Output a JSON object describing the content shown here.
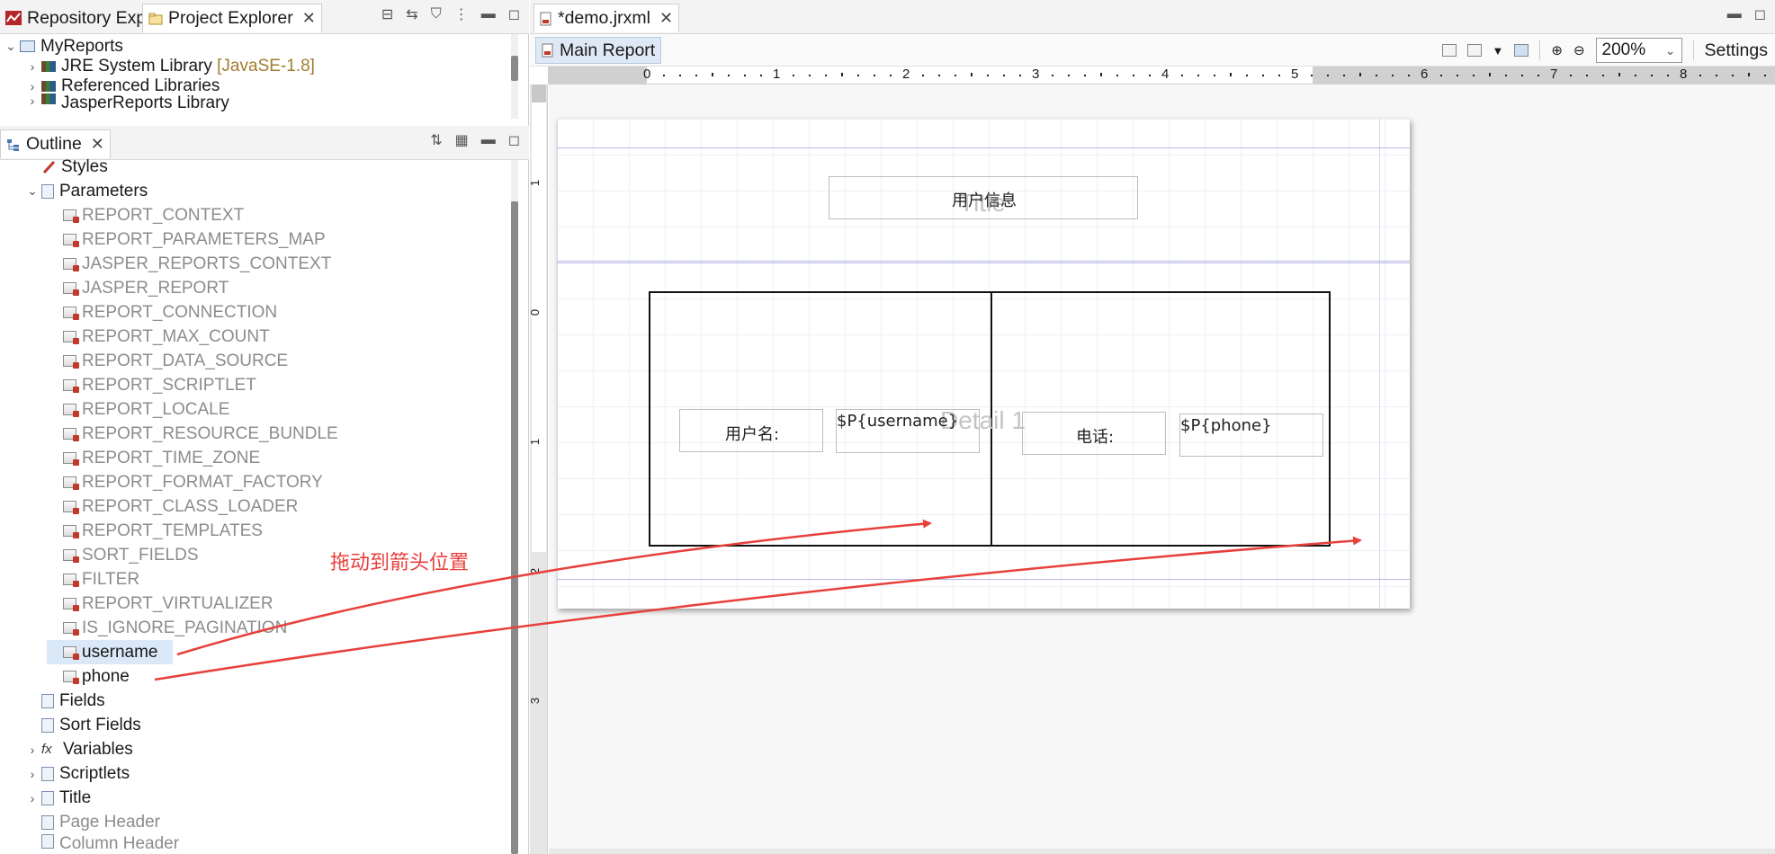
{
  "left_top": {
    "tabs": [
      {
        "label": "Repository Explorer",
        "active": false
      },
      {
        "label": "Project Explorer",
        "active": true
      }
    ],
    "tree": [
      {
        "label": "MyReports",
        "level": 0,
        "expanded": true
      },
      {
        "label": "JRE System Library",
        "suffix": "[JavaSE-1.8]",
        "level": 1
      },
      {
        "label": "Referenced Libraries",
        "level": 1
      },
      {
        "label": "JasperReports Library",
        "level": 1
      }
    ]
  },
  "outline": {
    "tab_label": "Outline",
    "styles": "Styles",
    "parameters": "Parameters",
    "params": [
      "REPORT_CONTEXT",
      "REPORT_PARAMETERS_MAP",
      "JASPER_REPORTS_CONTEXT",
      "JASPER_REPORT",
      "REPORT_CONNECTION",
      "REPORT_MAX_COUNT",
      "REPORT_DATA_SOURCE",
      "REPORT_SCRIPTLET",
      "REPORT_LOCALE",
      "REPORT_RESOURCE_BUNDLE",
      "REPORT_TIME_ZONE",
      "REPORT_FORMAT_FACTORY",
      "REPORT_CLASS_LOADER",
      "REPORT_TEMPLATES",
      "SORT_FIELDS",
      "FILTER",
      "REPORT_VIRTUALIZER",
      "IS_IGNORE_PAGINATION"
    ],
    "custom_params": [
      "username",
      "phone"
    ],
    "after": [
      "Fields",
      "Sort Fields",
      "Variables",
      "Scriptlets",
      "Title",
      "Page Header",
      "Column Header"
    ]
  },
  "editor": {
    "file_tab": "*demo.jrxml",
    "subtab": "Main Report",
    "zoom": "200%",
    "settings": "Settings",
    "ruler_numbers": [
      "0",
      "1",
      "2",
      "3",
      "4",
      "5",
      "6",
      "7",
      "8"
    ],
    "vruler_numbers": [
      "1",
      "0",
      "1",
      "2",
      "3"
    ]
  },
  "report": {
    "title_text": "用户信息",
    "title_band_label": "Title",
    "detail_band_label": "Detail 1",
    "label_username": "用户名:",
    "field_username": "$P{username}",
    "label_phone": "电话:",
    "field_phone": "$P{phone}"
  },
  "annotation": {
    "text": "拖动到箭头位置",
    "color": "#e8403c"
  }
}
